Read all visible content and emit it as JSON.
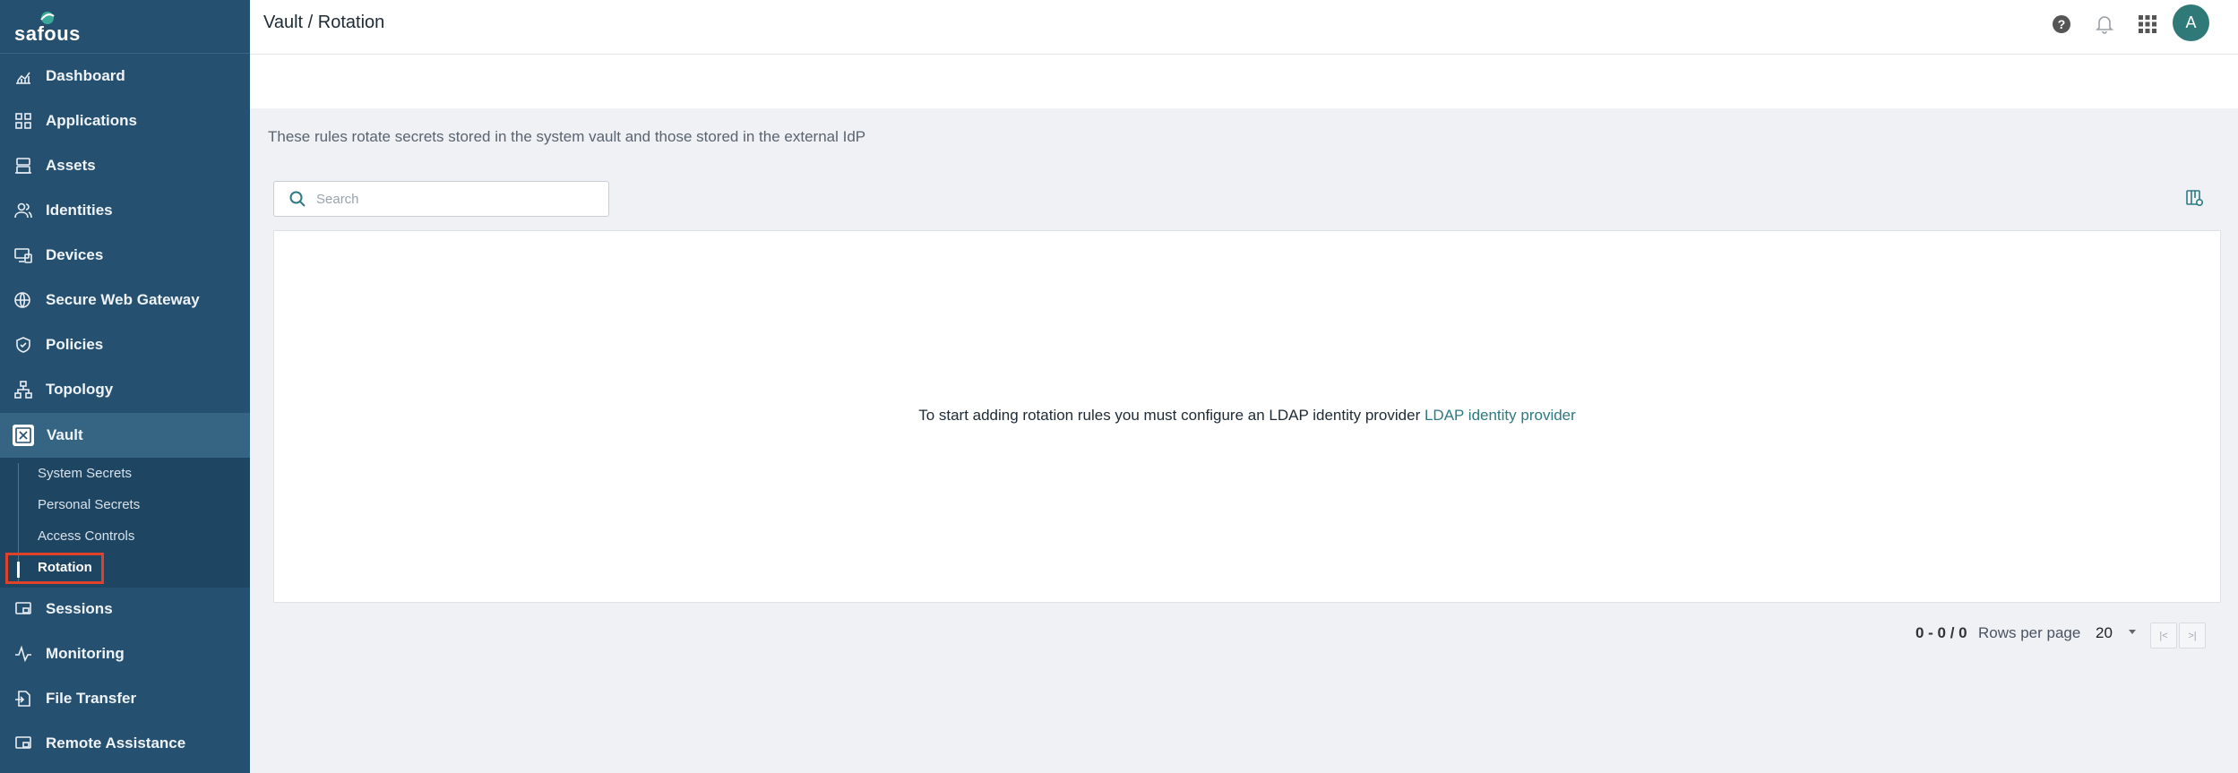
{
  "app": {
    "logo_text": "safous"
  },
  "header": {
    "breadcrumb": "Vault / Rotation",
    "avatar_initial": "A"
  },
  "sidebar": {
    "items": [
      {
        "label": "Dashboard",
        "icon": "chart-icon"
      },
      {
        "label": "Applications",
        "icon": "grid-icon"
      },
      {
        "label": "Assets",
        "icon": "server-icon"
      },
      {
        "label": "Identities",
        "icon": "users-icon"
      },
      {
        "label": "Devices",
        "icon": "devices-icon"
      },
      {
        "label": "Secure Web Gateway",
        "icon": "globe-shield-icon"
      },
      {
        "label": "Policies",
        "icon": "shield-icon"
      },
      {
        "label": "Topology",
        "icon": "topology-icon"
      },
      {
        "label": "Vault",
        "icon": "vault-icon",
        "active": true
      },
      {
        "label": "Sessions",
        "icon": "sessions-icon"
      },
      {
        "label": "Monitoring",
        "icon": "pulse-icon"
      },
      {
        "label": "File Transfer",
        "icon": "file-transfer-icon"
      },
      {
        "label": "Remote Assistance",
        "icon": "remote-icon"
      }
    ],
    "vault_submenu": [
      {
        "label": "System Secrets"
      },
      {
        "label": "Personal Secrets"
      },
      {
        "label": "Access Controls"
      },
      {
        "label": "Rotation",
        "active": true
      }
    ]
  },
  "main": {
    "description": "These rules rotate secrets stored in the system vault and those stored in the external IdP",
    "search": {
      "placeholder": "Search",
      "value": ""
    },
    "empty_message": "To start adding rotation rules you must configure an LDAP identity provider",
    "empty_link": "LDAP identity provider"
  },
  "pagination": {
    "range": "0 - 0 / 0",
    "rows_per_page_label": "Rows per page",
    "rows_per_page": "20"
  },
  "colors": {
    "sidebar_bg": "#26506f",
    "accent": "#2d7a84",
    "highlight": "#e0412a",
    "avatar": "#2f7a78"
  }
}
